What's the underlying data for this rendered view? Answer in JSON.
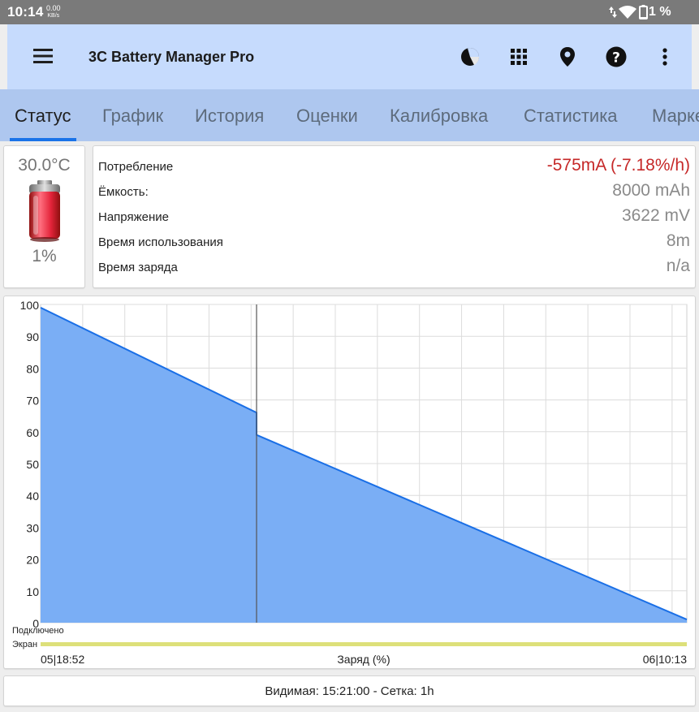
{
  "status_bar": {
    "time": "10:14",
    "net_speed": "0.00",
    "net_unit": "KB/s",
    "battery_pct": "1 %",
    "icons": [
      "data-arrows-icon",
      "wifi-icon",
      "battery-icon"
    ]
  },
  "app_bar": {
    "title": "3C Battery Manager Pro",
    "icons": [
      "menu-icon",
      "pie-chart-icon",
      "grid-apps-icon",
      "location-pin-icon",
      "help-icon",
      "more-vert-icon"
    ]
  },
  "tabs": [
    {
      "label": "Статус",
      "active": true
    },
    {
      "label": "График",
      "active": false
    },
    {
      "label": "История",
      "active": false
    },
    {
      "label": "Оценки",
      "active": false
    },
    {
      "label": "Калибровка",
      "active": false
    },
    {
      "label": "Статистика",
      "active": false
    },
    {
      "label": "Марке",
      "active": false
    }
  ],
  "battery": {
    "temperature": "30.0°C",
    "level": "1%"
  },
  "info": {
    "consumption_label": "Потребление",
    "consumption_value": "-575mA (-7.18%/h)",
    "capacity_label": "Ёмкость:",
    "capacity_value": "8000 mAh",
    "voltage_label": "Напряжение",
    "voltage_value": "3622 mV",
    "usage_time_label": "Время использования",
    "usage_time_value": "8m",
    "charge_time_label": "Время заряда",
    "charge_time_value": "n/a"
  },
  "chart_data": {
    "type": "area",
    "xlabel": "Заряд (%)",
    "x_start_label": "05|18:52",
    "x_end_label": "06|10:13",
    "ylim": [
      0,
      100
    ],
    "yticks": [
      0,
      10,
      20,
      30,
      40,
      50,
      60,
      70,
      80,
      90,
      100
    ],
    "grid": true,
    "x_hours": [
      0,
      5.13,
      5.13,
      15.35
    ],
    "y_values": [
      99,
      66,
      59,
      1
    ],
    "marker_hour": 5.13,
    "tracks": [
      {
        "label": "Подключено",
        "color": ""
      },
      {
        "label": "Экран",
        "color": "#dde07a"
      }
    ],
    "colors": {
      "fill": "#7aaef5",
      "line": "#1a6fe6",
      "grid": "#dcdcdc"
    }
  },
  "footer": {
    "text": "Видимая: 15:21:00 - Сетка: 1h"
  }
}
